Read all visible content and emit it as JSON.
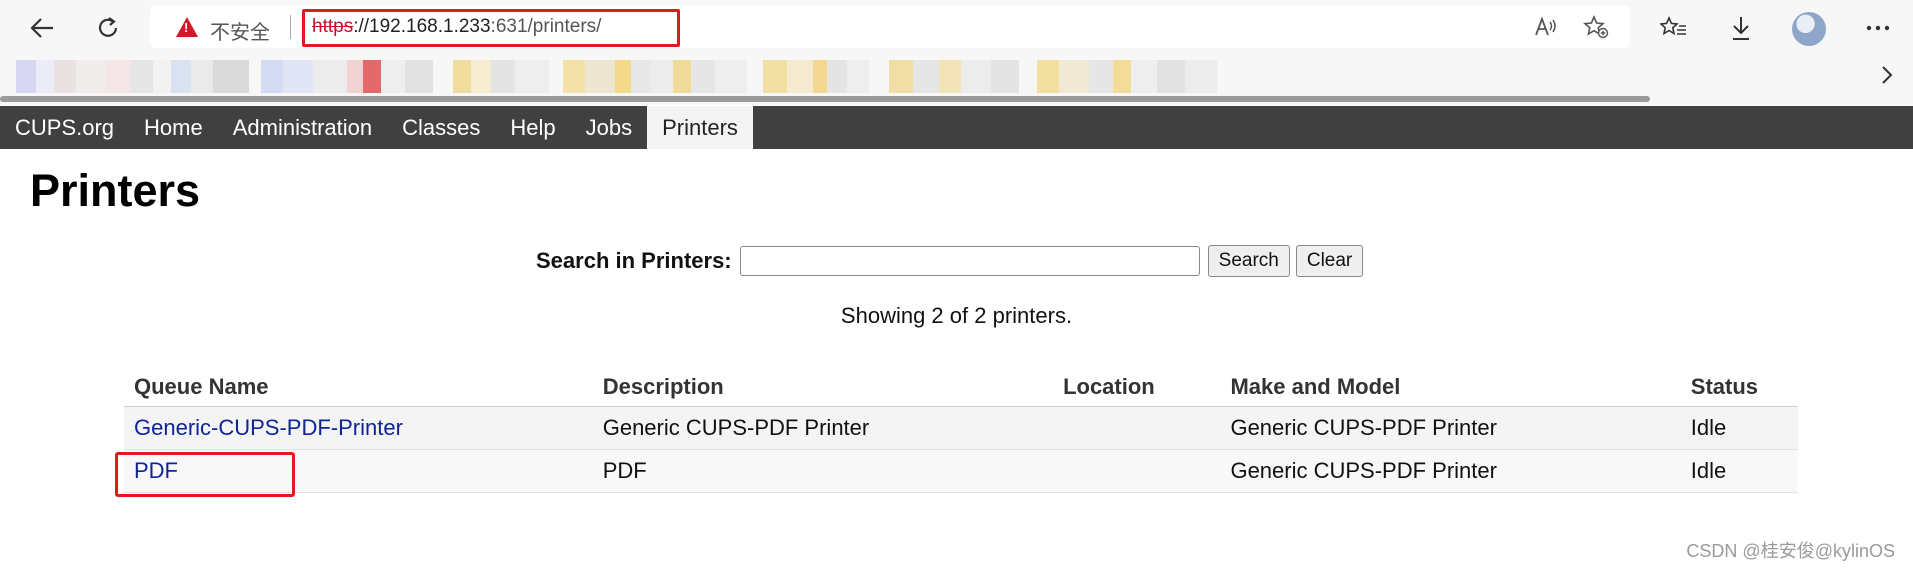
{
  "browser": {
    "security_label": "不安全",
    "url_scheme": "https",
    "url_host": "://192.168.1.233",
    "url_rest": ":631/printers/",
    "icons": [
      "back-icon",
      "refresh-icon",
      "warning-icon",
      "read-aloud-icon",
      "add-favorite-icon",
      "favorites-icon",
      "download-icon",
      "more-icon",
      "chevron-right-icon"
    ]
  },
  "nav": {
    "items": [
      {
        "label": "CUPS.org"
      },
      {
        "label": "Home"
      },
      {
        "label": "Administration"
      },
      {
        "label": "Classes"
      },
      {
        "label": "Help"
      },
      {
        "label": "Jobs"
      },
      {
        "label": "Printers"
      }
    ]
  },
  "page": {
    "title": "Printers",
    "search_label": "Search in Printers:",
    "search_value": "",
    "search_button": "Search",
    "clear_button": "Clear",
    "showing_text": "Showing 2 of 2 printers."
  },
  "table": {
    "headers": [
      "Queue Name",
      "Description",
      "Location",
      "Make and Model",
      "Status"
    ],
    "rows": [
      {
        "queue": "Generic-CUPS-PDF-Printer",
        "description": "Generic CUPS-PDF Printer",
        "location": "",
        "model": "Generic CUPS-PDF Printer",
        "status": "Idle"
      },
      {
        "queue": "PDF",
        "description": "PDF",
        "location": "",
        "model": "Generic CUPS-PDF Printer",
        "status": "Idle"
      }
    ]
  },
  "watermark": "CSDN @桂安俊@kylinOS",
  "colors": {
    "nav_bg": "#404040",
    "link": "#0f2496",
    "highlight": "#e01b1b",
    "warning": "#d0192a"
  }
}
